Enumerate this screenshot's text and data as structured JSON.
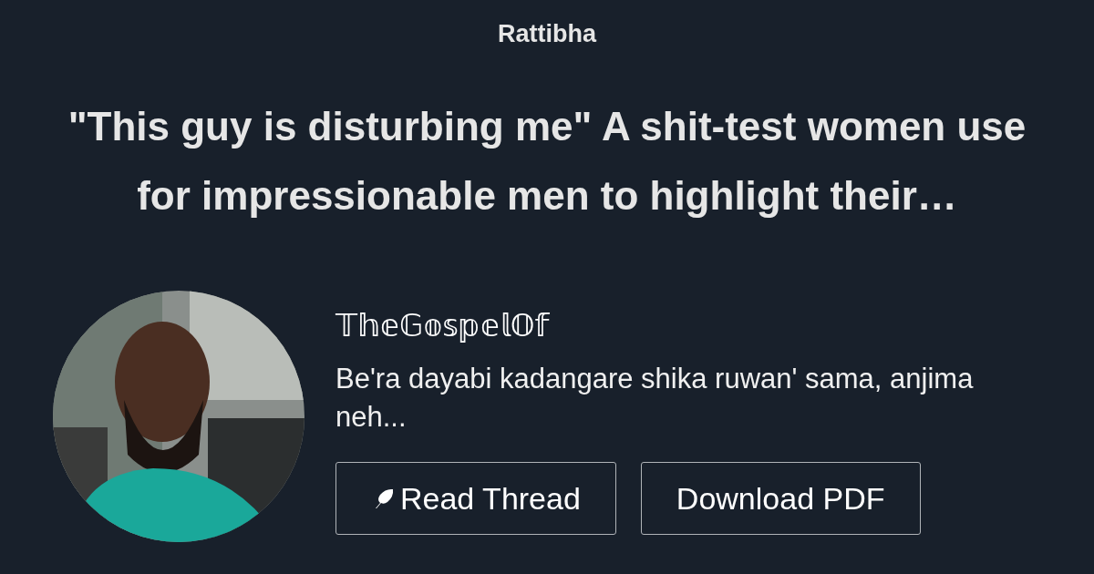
{
  "site": {
    "name": "Rattibha"
  },
  "thread": {
    "title": "\"This guy is disturbing me\" A shit-test women use for impressionable men to highlight their…"
  },
  "author": {
    "name": "𝕋𝕙𝕖𝔾𝕠𝕤𝕡𝕖𝕝𝕆𝕗",
    "bio": "Be'ra dayabi kadangare shika ruwan' sama, anjima neh..."
  },
  "buttons": [
    {
      "kind": "read",
      "label": "Read Thread"
    },
    {
      "kind": "download",
      "label": "Download PDF"
    }
  ]
}
